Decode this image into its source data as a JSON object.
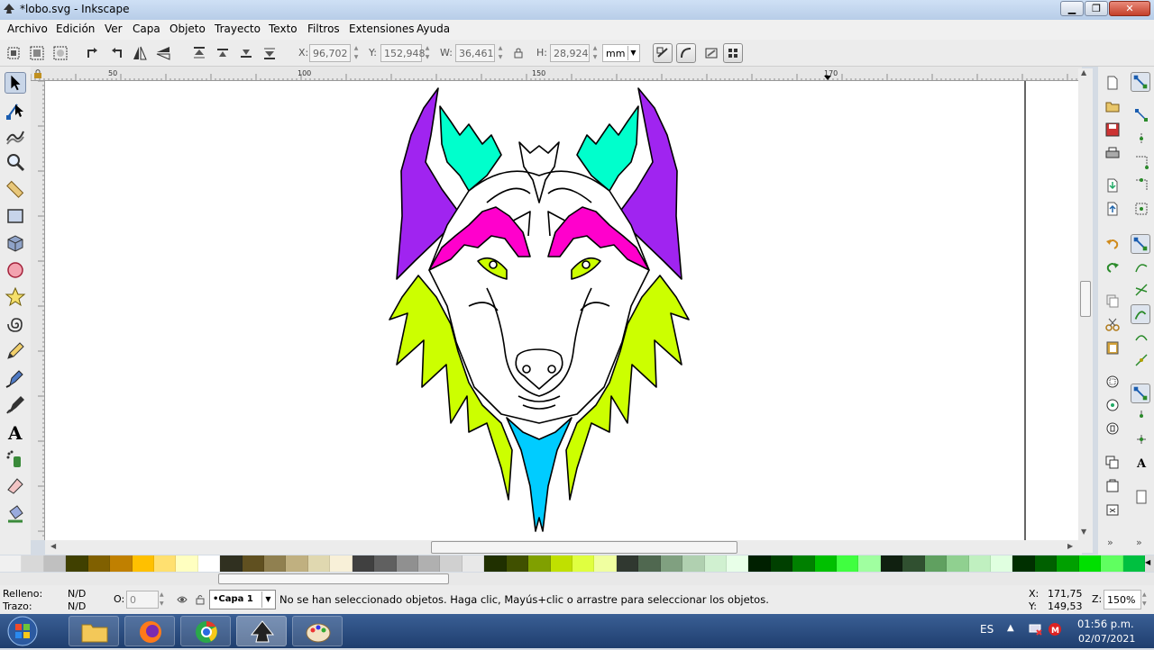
{
  "window": {
    "title": "*lobo.svg - Inkscape"
  },
  "menu": [
    "Archivo",
    "Edición",
    "Ver",
    "Capa",
    "Objeto",
    "Trayecto",
    "Texto",
    "Filtros",
    "Extensiones",
    "Ayuda"
  ],
  "toolbar": {
    "x_label": "X:",
    "x_value": "96,702",
    "y_label": "Y:",
    "y_value": "152,948",
    "w_label": "W:",
    "w_value": "36,461",
    "h_label": "H:",
    "h_value": "28,924",
    "unit": "mm"
  },
  "ruler_top": [
    "50",
    "100",
    "150",
    "170"
  ],
  "status": {
    "fill_label": "Relleno:",
    "fill_value": "N/D",
    "stroke_label": "Trazo:",
    "stroke_value": "N/D",
    "opacity_label": "O:",
    "opacity_value": "0",
    "layer": "•Capa 1",
    "message": "No se han seleccionado objetos. Haga clic, Mayús+clic o arrastre para seleccionar los objetos.",
    "cursor_x_label": "X:",
    "cursor_x": "171,75",
    "cursor_y_label": "Y:",
    "cursor_y": "149,53",
    "zoom_label": "Z:",
    "zoom": "150%"
  },
  "taskbar": {
    "language": "ES",
    "time": "01:56 p.m.",
    "date": "02/07/2021"
  },
  "colors": {
    "purple": "#a024f0",
    "cyan": "#00ffcc",
    "magenta": "#ff00cc",
    "lime": "#ccff00",
    "blue": "#00ccff",
    "stroke": "#000000"
  },
  "palette": [
    "#f0f0f0",
    "#d8d8d8",
    "#c0c0c0",
    "#404000",
    "#806000",
    "#c08000",
    "#ffc000",
    "#ffe070",
    "#ffffc0",
    "#ffffff",
    "#303020",
    "#605020",
    "#908050",
    "#c0b080",
    "#e0d8b0",
    "#f8f0d8",
    "#404040",
    "#606060",
    "#909090",
    "#b0b0b0",
    "#d0d0d0",
    "#e8e8e8",
    "#203000",
    "#405000",
    "#80a000",
    "#c0e000",
    "#e0ff40",
    "#f0ffa0",
    "#303830",
    "#506850",
    "#80a080",
    "#b0d0b0",
    "#d0f0d0",
    "#e8ffe8",
    "#002000",
    "#004000",
    "#008000",
    "#00c000",
    "#40ff40",
    "#a0ffa0",
    "#102010",
    "#305030",
    "#60a060",
    "#90d090",
    "#c0f0c0",
    "#e0ffe0",
    "#003000",
    "#006000",
    "#00a000",
    "#00e000",
    "#60ff60",
    "#00c040"
  ]
}
